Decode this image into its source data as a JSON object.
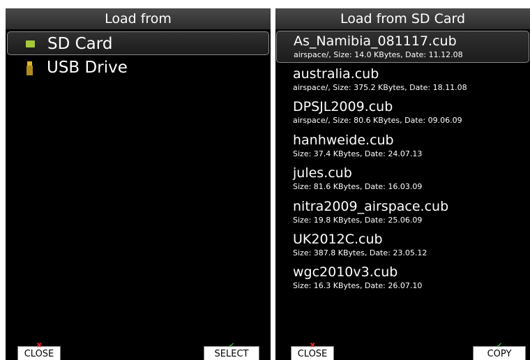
{
  "left": {
    "title": "Load from",
    "devices": [
      {
        "label": "SD Card",
        "icon": "sd-card-icon",
        "selected": true
      },
      {
        "label": "USB Drive",
        "icon": "usb-drive-icon",
        "selected": false
      }
    ],
    "close_label": "CLOSE",
    "close_mark": "✖",
    "select_label": "SELECT",
    "select_mark": "✔"
  },
  "right": {
    "title": "Load from SD Card",
    "files": [
      {
        "name": "As_Namibia_081117.cub",
        "meta": "airspace/, Size: 14.0 KBytes, Date: 11.12.08"
      },
      {
        "name": "australia.cub",
        "meta": "airspace/, Size: 375.2 KBytes, Date: 18.11.08"
      },
      {
        "name": "DPSJL2009.cub",
        "meta": "airspace/, Size: 80.6 KBytes, Date: 09.06.09"
      },
      {
        "name": "hanhweide.cub",
        "meta": "Size: 37.4 KBytes, Date: 24.07.13"
      },
      {
        "name": "jules.cub",
        "meta": "Size: 81.6 KBytes, Date: 16.03.09"
      },
      {
        "name": "nitra2009_airspace.cub",
        "meta": "Size: 19.8 KBytes, Date: 25.06.09"
      },
      {
        "name": "UK2012C.cub",
        "meta": "Size: 387.8 KBytes, Date: 23.05.12"
      },
      {
        "name": "wgc2010v3.cub",
        "meta": "Size: 16.3 KBytes, Date: 26.07.10"
      }
    ],
    "selected_index": 0,
    "close_label": "CLOSE",
    "close_mark": "✖",
    "copy_label": "COPY",
    "copy_mark": "✔"
  },
  "colors": {
    "background": "#000000",
    "title_bar": "#3a3a3a",
    "sd_icon": "#a6c93a",
    "usb_icon": "#e0b52a",
    "close_mark": "#e02020",
    "ok_mark": "#2aa02a"
  }
}
